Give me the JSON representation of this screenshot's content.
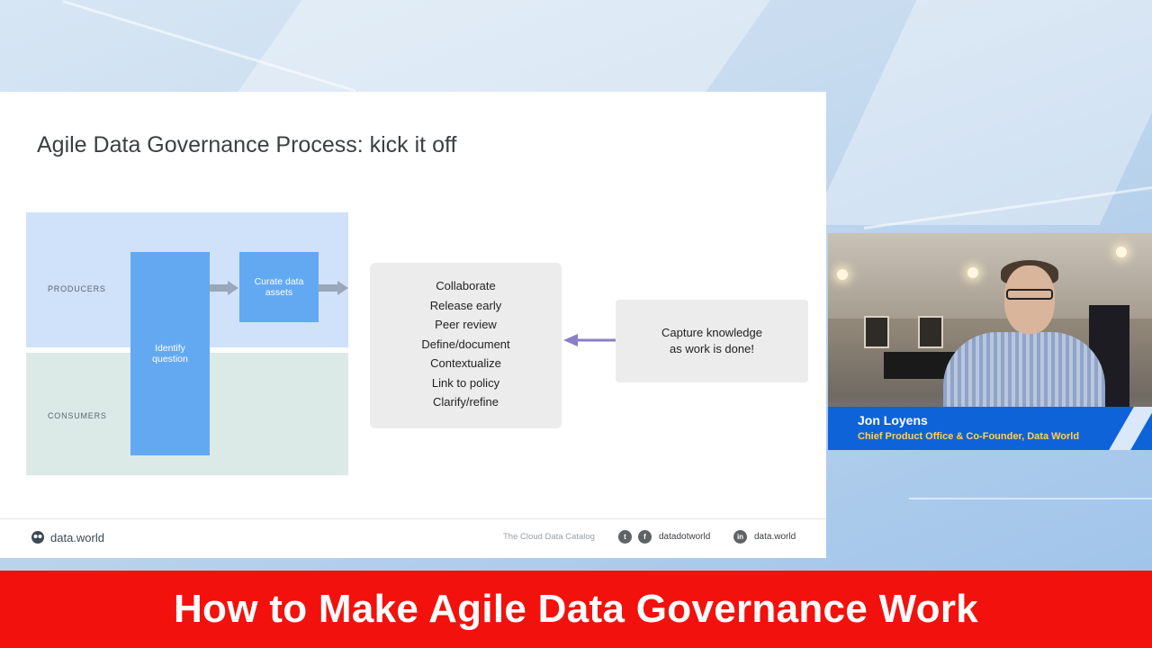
{
  "slide": {
    "title": "Agile Data Governance Process: kick it off",
    "lanes": {
      "producers": "PRODUCERS",
      "consumers": "CONSUMERS"
    },
    "boxes": {
      "identify": "Identify question",
      "curate": "Curate data assets"
    },
    "steps": [
      "Collaborate",
      "Release early",
      "Peer review",
      "Define/document",
      "Contextualize",
      "Link to policy",
      "Clarify/refine"
    ],
    "capture": "Capture knowledge as work is done!",
    "footer": {
      "brand": "data.world",
      "tagline": "The Cloud Data Catalog",
      "social_handle": "datadotworld",
      "linkedin_handle": "data.world",
      "icons": [
        "twitter-icon",
        "facebook-icon",
        "linkedin-icon"
      ]
    },
    "colors": {
      "arrow": "#8b7fc7",
      "box_blue": "#63a9f2",
      "lane_blue": "#cfe2fa",
      "lane_green": "#dceae7"
    }
  },
  "speaker": {
    "name": "Jon Loyens",
    "title": "Chief Product Office & Co-Founder, Data World"
  },
  "banner": {
    "text": "How to Make Agile Data Governance Work",
    "color": "#f3110d"
  }
}
